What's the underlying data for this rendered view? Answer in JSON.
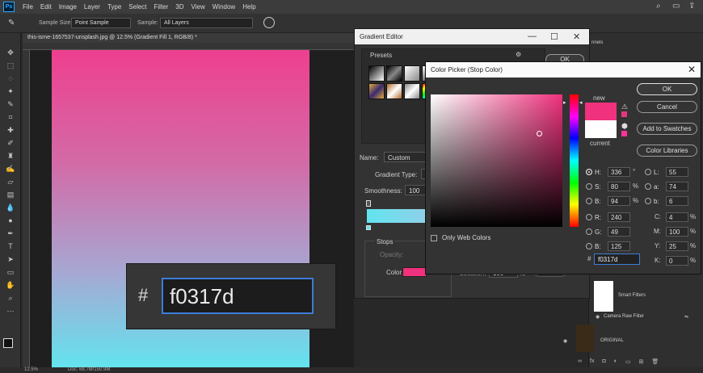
{
  "app": {
    "logo": "Ps",
    "menu": [
      "File",
      "Edit",
      "Image",
      "Layer",
      "Type",
      "Select",
      "Filter",
      "3D",
      "View",
      "Window",
      "Help"
    ]
  },
  "options_bar": {
    "sample_size_label": "Sample Size:",
    "sample_size_value": "Point Sample",
    "sample_label": "Sample:",
    "sample_value": "All Layers"
  },
  "document": {
    "tab_title": "this-isme-1657537-unsplash.jpg @ 12.5% (Gradient Fill 1, RGB/8) *",
    "zoom": "12.5%",
    "doc_size": "Doc: 68.7M/150.9M"
  },
  "hex_overlay": {
    "hash": "#",
    "value": "f0317d"
  },
  "gradient_editor": {
    "title": "Gradient Editor",
    "presets_label": "Presets",
    "ok_label": "OK",
    "name_label": "Name:",
    "name_value": "Custom",
    "gradient_type_label": "Gradient Type:",
    "smoothness_label": "Smoothness:",
    "smoothness_value": "100",
    "stops_label": "Stops",
    "opacity_label": "Opacity:",
    "color_label": "Color:",
    "location_label": "Location:",
    "location_value": "100",
    "location_unit": "%",
    "delete_label": "Delete"
  },
  "color_picker": {
    "title": "Color Picker (Stop Color)",
    "new_label": "new",
    "current_label": "current",
    "buttons": {
      "ok": "OK",
      "cancel": "Cancel",
      "add_to_swatches": "Add to Swatches",
      "color_libraries": "Color Libraries"
    },
    "only_web_colors": "Only Web Colors",
    "hsb": [
      {
        "label": "H:",
        "value": "336",
        "unit": "°"
      },
      {
        "label": "S:",
        "value": "80",
        "unit": "%"
      },
      {
        "label": "B:",
        "value": "94",
        "unit": "%"
      }
    ],
    "rgb": [
      {
        "label": "R:",
        "value": "240"
      },
      {
        "label": "G:",
        "value": "49"
      },
      {
        "label": "B:",
        "value": "125"
      }
    ],
    "lab": [
      {
        "label": "L:",
        "value": "55"
      },
      {
        "label": "a:",
        "value": "74"
      },
      {
        "label": "b:",
        "value": "6"
      }
    ],
    "cmyk": [
      {
        "label": "C:",
        "value": "4",
        "unit": "%"
      },
      {
        "label": "M:",
        "value": "100",
        "unit": "%"
      },
      {
        "label": "Y:",
        "value": "25",
        "unit": "%"
      },
      {
        "label": "K:",
        "value": "0",
        "unit": "%"
      }
    ],
    "hex_label": "#",
    "hex_value": "f0317d",
    "new_color": "#f0317d",
    "current_color": "#ffffff"
  },
  "layers_panel": {
    "tab_fragment": "nnels",
    "smart_filters": "Smart Filters",
    "camera_raw": "Camera Raw Filter",
    "original": "ORIGINAL"
  }
}
